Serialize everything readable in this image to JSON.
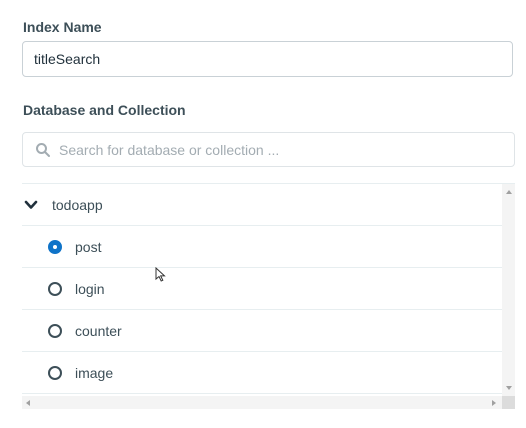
{
  "index_name": {
    "label": "Index Name",
    "value": "titleSearch"
  },
  "db_collection": {
    "label": "Database and Collection",
    "search": {
      "placeholder": "Search for database or collection ...",
      "icon": "search-icon"
    },
    "tree": {
      "database": {
        "name": "todoapp",
        "expanded": true,
        "icon": "chevron-down-icon"
      },
      "collections": [
        {
          "name": "post",
          "selected": true
        },
        {
          "name": "login",
          "selected": false
        },
        {
          "name": "counter",
          "selected": false
        },
        {
          "name": "image",
          "selected": false
        }
      ]
    }
  },
  "colors": {
    "accent": "#0f73c8",
    "text": "#3d4f58",
    "border": "#c9d1d6"
  }
}
